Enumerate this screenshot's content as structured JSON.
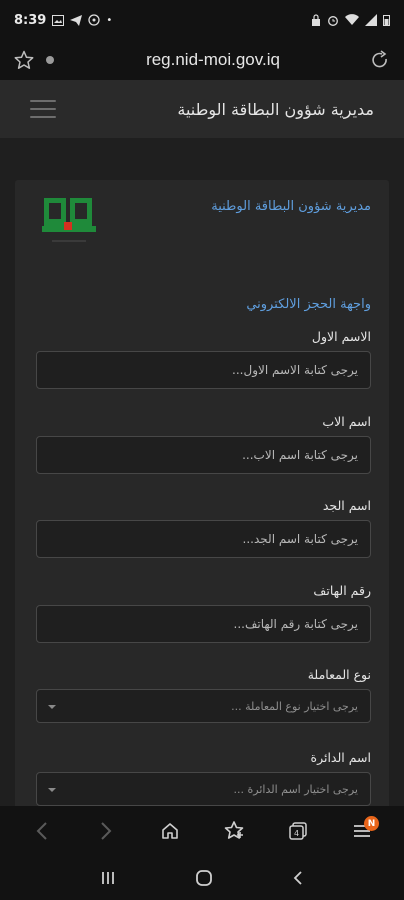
{
  "status_bar": {
    "time": "8:39"
  },
  "browser": {
    "url": "reg.nid-moi.gov.iq"
  },
  "header": {
    "title": "مديرية شؤون البطاقة الوطنية"
  },
  "card": {
    "org_name": "مديرية شؤون البطاقة الوطنية",
    "section_title": "واجهة الحجز الالكتروني"
  },
  "form": {
    "first_name": {
      "label": "الاسم الاول",
      "placeholder": "يرجى كتابة الاسم الاول..."
    },
    "father_name": {
      "label": "اسم الاب",
      "placeholder": "يرجى كتابة اسم الاب..."
    },
    "grandfather_name": {
      "label": "اسم الجد",
      "placeholder": "يرجى كتابة اسم الجد..."
    },
    "phone": {
      "label": "رقم الهاتف",
      "placeholder": "يرجى كتابة رقم الهاتف..."
    },
    "transaction_type": {
      "label": "نوع المعاملة",
      "selected": "يرجى اختيار نوع المعاملة ..."
    },
    "department": {
      "label": "اسم الدائرة",
      "selected": "يرجى اختيار اسم الدائرة ..."
    }
  },
  "bottom_nav": {
    "notification_badge": "N"
  },
  "colors": {
    "accent": "#5f9ede",
    "badge": "#e8651a",
    "logo_green": "#1f8a3a",
    "logo_red": "#d6301f"
  },
  "icons": [
    "star-outline-icon",
    "info-dot-icon",
    "reload-icon",
    "hamburger-menu-icon",
    "back-arrow-icon",
    "forward-arrow-icon",
    "home-icon",
    "bookmarks-icon",
    "tabs-icon",
    "menu-icon"
  ]
}
